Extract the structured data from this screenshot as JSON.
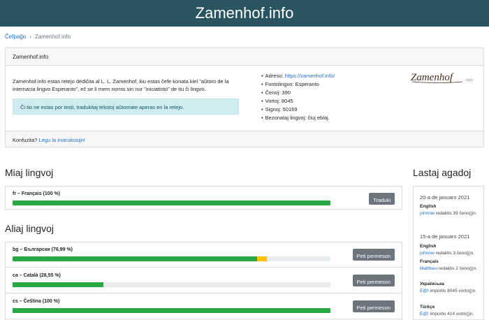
{
  "header": {
    "title": "Zamenhof.info"
  },
  "breadcrumb": {
    "home": "Ĉefpaĝo",
    "separator": "›",
    "current": "Zamenhof.info"
  },
  "info": {
    "card_title": "Zamenhof.info",
    "description": "Zamenhof.info estas retejo dediĉita al L. L. Zamenhof, kiu estas ĉefe konata kiel \"aŭtoro de la internacia lingvo Esperanto\", eĉ se li mem nomis sin nur \"iniciatinto\" de tiu ĉi lingvo.",
    "notice": "Ĉi tio ne estas por testi, tradukitaj tekstoj aŭtomate aperas en la retejo.",
    "meta": {
      "address_label": "Adreso:",
      "address_link": "https://zamenhof.info/",
      "source_language": "Fontolingvo: Esperanto",
      "strings": "Ĉenoj: 390",
      "words": "Vortoj: 8045",
      "signs": "Signoj: 50169",
      "unneeded": "Bezonataj lingvoj: ĉiuj eblaj."
    },
    "logo_text": "Zamenhof",
    "logo_suffix": ".info",
    "footer_text": "Konfuzita?",
    "footer_link": "Legu la instrukciojn!"
  },
  "my_languages": {
    "title": "Miaj lingvoj",
    "items": [
      {
        "name": "fr – Français (100 %)",
        "button": "Traduki",
        "progress": 100,
        "fuzzy": 0
      }
    ]
  },
  "other_languages": {
    "title": "Aliaj lingvoj",
    "items": [
      {
        "name": "bg – Български (76,99 %)",
        "button": "Peti permeson",
        "progress": 76.99,
        "fuzzy": 3.0
      },
      {
        "name": "ca – Català (28,55 %)",
        "button": "Peti permeson",
        "progress": 28.55,
        "fuzzy": 0
      },
      {
        "name": "cs – Čeština (100 %)",
        "button": "Peti permeson",
        "progress": 100,
        "fuzzy": 0
      }
    ]
  },
  "recent": {
    "title": "Lastaj agadoj",
    "date1": "20-a de januaro 2021",
    "g1_lang": "English",
    "g1_user": "johnnie",
    "g1_text": " redaktis 39 ĉeno(j)n.",
    "date2": "15-a de januaro 2021",
    "g2_lang": "English",
    "g2_user": "johnnie",
    "g2_text": " redaktis 3 ĉeno(j)n.",
    "g3_lang": "Français",
    "g3_user": "Matthieu",
    "g3_text": " redaktis 2 ĉeno(j)n.",
    "g4_lang": "Українська",
    "g4_user": "E@I",
    "g4_text": " importis 8045 vorto(j)n.",
    "g5_lang": "Türkçe",
    "g5_user": "E@I",
    "g5_text": " importis 414 vorto(j)n."
  },
  "colors": {
    "header_bg": "#2a5560",
    "progress_green": "#28a745",
    "progress_fuzzy": "#ffc107",
    "button_gray": "#6c757d"
  }
}
